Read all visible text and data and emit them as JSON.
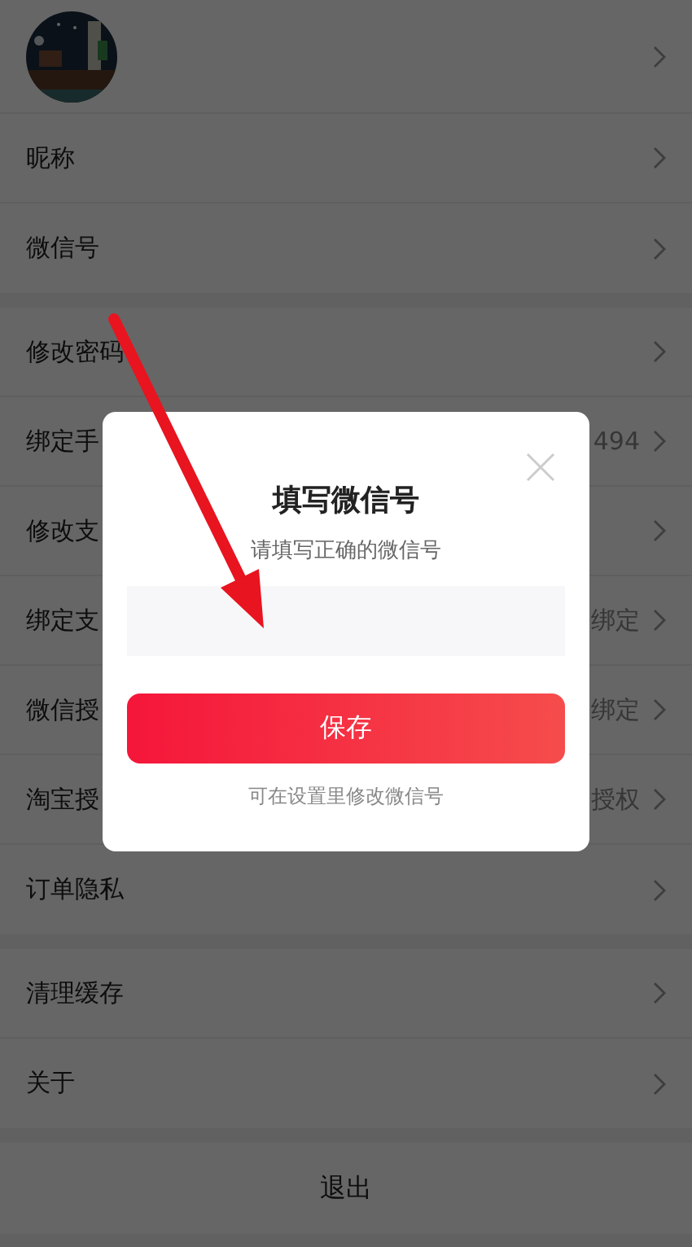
{
  "sections": [
    {
      "rows": [
        {
          "kind": "avatar"
        },
        {
          "kind": "item",
          "label": "昵称"
        },
        {
          "kind": "item",
          "label": "微信号"
        }
      ]
    },
    {
      "rows": [
        {
          "kind": "item",
          "label": "修改密码"
        },
        {
          "kind": "item",
          "label": "绑定手",
          "value": "494"
        },
        {
          "kind": "item",
          "label": "修改支"
        },
        {
          "kind": "item",
          "label": "绑定支",
          "value": "绑定"
        },
        {
          "kind": "item",
          "label": "微信授",
          "value": "绑定"
        },
        {
          "kind": "item",
          "label": "淘宝授",
          "value": "授权"
        },
        {
          "kind": "item",
          "label": "订单隐私"
        }
      ]
    },
    {
      "rows": [
        {
          "kind": "item",
          "label": "清理缓存"
        },
        {
          "kind": "item",
          "label": "关于"
        }
      ]
    }
  ],
  "logout": "退出",
  "dialog": {
    "title": "填写微信号",
    "subtitle": "请填写正确的微信号",
    "save_button": "保存",
    "hint": "可在设置里修改微信号"
  }
}
